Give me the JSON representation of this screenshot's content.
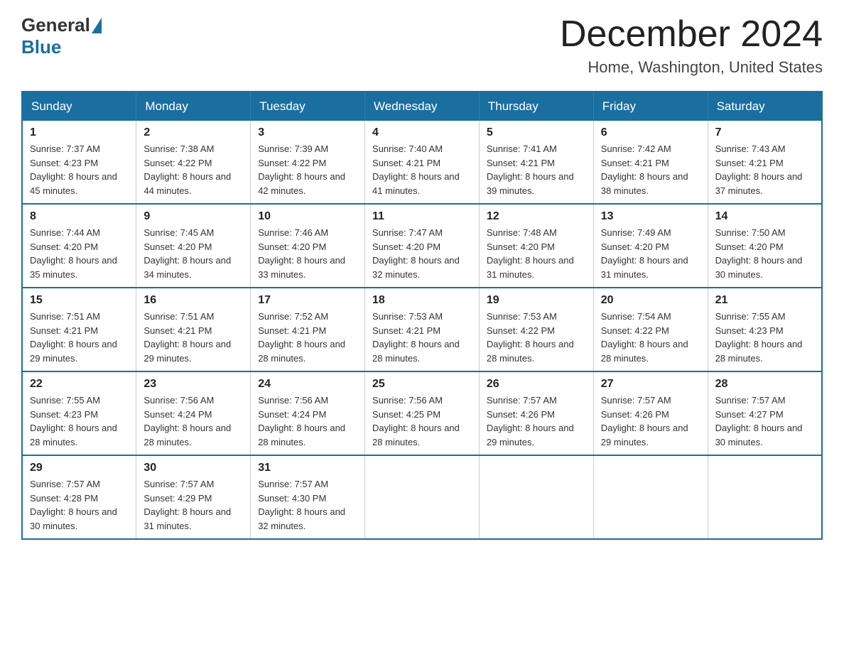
{
  "logo": {
    "general": "General",
    "blue": "Blue"
  },
  "title": "December 2024",
  "location": "Home, Washington, United States",
  "days_of_week": [
    "Sunday",
    "Monday",
    "Tuesday",
    "Wednesday",
    "Thursday",
    "Friday",
    "Saturday"
  ],
  "weeks": [
    [
      {
        "day": "1",
        "sunrise": "7:37 AM",
        "sunset": "4:23 PM",
        "daylight": "8 hours and 45 minutes."
      },
      {
        "day": "2",
        "sunrise": "7:38 AM",
        "sunset": "4:22 PM",
        "daylight": "8 hours and 44 minutes."
      },
      {
        "day": "3",
        "sunrise": "7:39 AM",
        "sunset": "4:22 PM",
        "daylight": "8 hours and 42 minutes."
      },
      {
        "day": "4",
        "sunrise": "7:40 AM",
        "sunset": "4:21 PM",
        "daylight": "8 hours and 41 minutes."
      },
      {
        "day": "5",
        "sunrise": "7:41 AM",
        "sunset": "4:21 PM",
        "daylight": "8 hours and 39 minutes."
      },
      {
        "day": "6",
        "sunrise": "7:42 AM",
        "sunset": "4:21 PM",
        "daylight": "8 hours and 38 minutes."
      },
      {
        "day": "7",
        "sunrise": "7:43 AM",
        "sunset": "4:21 PM",
        "daylight": "8 hours and 37 minutes."
      }
    ],
    [
      {
        "day": "8",
        "sunrise": "7:44 AM",
        "sunset": "4:20 PM",
        "daylight": "8 hours and 35 minutes."
      },
      {
        "day": "9",
        "sunrise": "7:45 AM",
        "sunset": "4:20 PM",
        "daylight": "8 hours and 34 minutes."
      },
      {
        "day": "10",
        "sunrise": "7:46 AM",
        "sunset": "4:20 PM",
        "daylight": "8 hours and 33 minutes."
      },
      {
        "day": "11",
        "sunrise": "7:47 AM",
        "sunset": "4:20 PM",
        "daylight": "8 hours and 32 minutes."
      },
      {
        "day": "12",
        "sunrise": "7:48 AM",
        "sunset": "4:20 PM",
        "daylight": "8 hours and 31 minutes."
      },
      {
        "day": "13",
        "sunrise": "7:49 AM",
        "sunset": "4:20 PM",
        "daylight": "8 hours and 31 minutes."
      },
      {
        "day": "14",
        "sunrise": "7:50 AM",
        "sunset": "4:20 PM",
        "daylight": "8 hours and 30 minutes."
      }
    ],
    [
      {
        "day": "15",
        "sunrise": "7:51 AM",
        "sunset": "4:21 PM",
        "daylight": "8 hours and 29 minutes."
      },
      {
        "day": "16",
        "sunrise": "7:51 AM",
        "sunset": "4:21 PM",
        "daylight": "8 hours and 29 minutes."
      },
      {
        "day": "17",
        "sunrise": "7:52 AM",
        "sunset": "4:21 PM",
        "daylight": "8 hours and 28 minutes."
      },
      {
        "day": "18",
        "sunrise": "7:53 AM",
        "sunset": "4:21 PM",
        "daylight": "8 hours and 28 minutes."
      },
      {
        "day": "19",
        "sunrise": "7:53 AM",
        "sunset": "4:22 PM",
        "daylight": "8 hours and 28 minutes."
      },
      {
        "day": "20",
        "sunrise": "7:54 AM",
        "sunset": "4:22 PM",
        "daylight": "8 hours and 28 minutes."
      },
      {
        "day": "21",
        "sunrise": "7:55 AM",
        "sunset": "4:23 PM",
        "daylight": "8 hours and 28 minutes."
      }
    ],
    [
      {
        "day": "22",
        "sunrise": "7:55 AM",
        "sunset": "4:23 PM",
        "daylight": "8 hours and 28 minutes."
      },
      {
        "day": "23",
        "sunrise": "7:56 AM",
        "sunset": "4:24 PM",
        "daylight": "8 hours and 28 minutes."
      },
      {
        "day": "24",
        "sunrise": "7:56 AM",
        "sunset": "4:24 PM",
        "daylight": "8 hours and 28 minutes."
      },
      {
        "day": "25",
        "sunrise": "7:56 AM",
        "sunset": "4:25 PM",
        "daylight": "8 hours and 28 minutes."
      },
      {
        "day": "26",
        "sunrise": "7:57 AM",
        "sunset": "4:26 PM",
        "daylight": "8 hours and 29 minutes."
      },
      {
        "day": "27",
        "sunrise": "7:57 AM",
        "sunset": "4:26 PM",
        "daylight": "8 hours and 29 minutes."
      },
      {
        "day": "28",
        "sunrise": "7:57 AM",
        "sunset": "4:27 PM",
        "daylight": "8 hours and 30 minutes."
      }
    ],
    [
      {
        "day": "29",
        "sunrise": "7:57 AM",
        "sunset": "4:28 PM",
        "daylight": "8 hours and 30 minutes."
      },
      {
        "day": "30",
        "sunrise": "7:57 AM",
        "sunset": "4:29 PM",
        "daylight": "8 hours and 31 minutes."
      },
      {
        "day": "31",
        "sunrise": "7:57 AM",
        "sunset": "4:30 PM",
        "daylight": "8 hours and 32 minutes."
      },
      null,
      null,
      null,
      null
    ]
  ]
}
